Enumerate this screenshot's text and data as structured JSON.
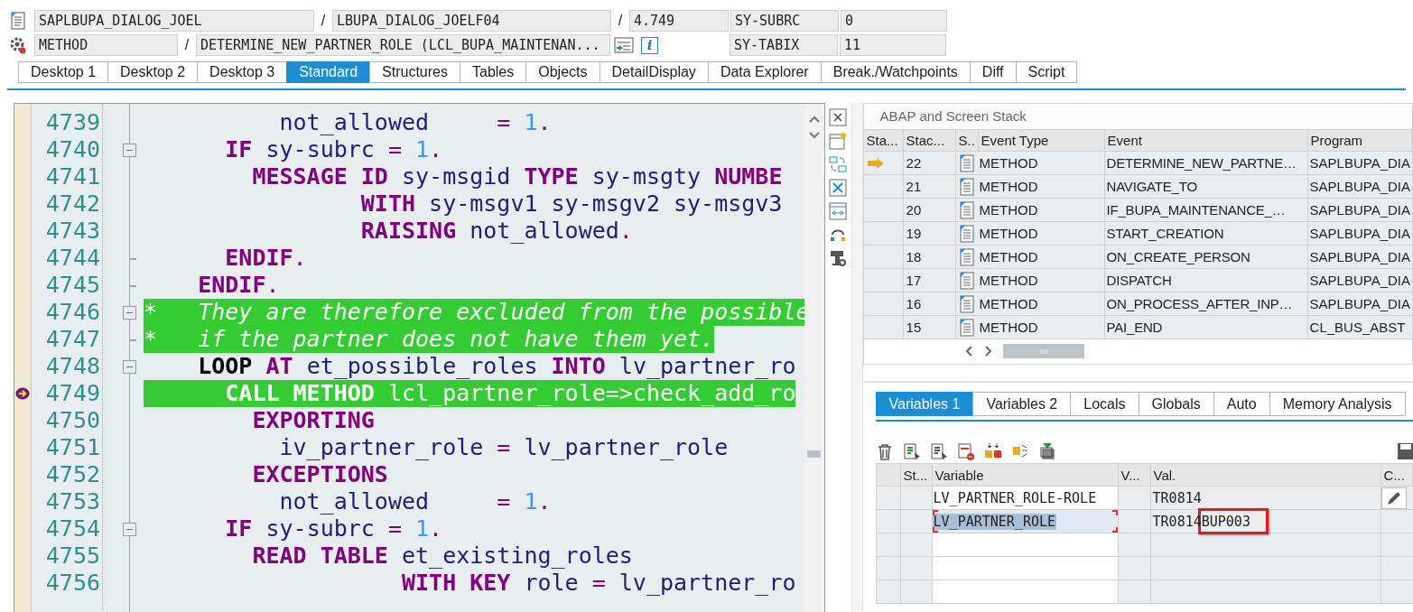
{
  "header": {
    "program": "SAPLBUPA_DIALOG_JOEL",
    "include": "LBUPA_DIALOG_JOELF04",
    "line": "4.749",
    "event_type": "METHOD",
    "event": "DETERMINE_NEW_PARTNER_ROLE (LCL_BUPA_MAINTENAN...",
    "separators": [
      "/",
      "/",
      "/"
    ],
    "info_icon": "i",
    "system_fields": [
      {
        "name": "SY-SUBRC",
        "value": "0"
      },
      {
        "name": "SY-TABIX",
        "value": "11"
      }
    ]
  },
  "tabs": [
    {
      "label": "Desktop 1",
      "selected": false
    },
    {
      "label": "Desktop 2",
      "selected": false
    },
    {
      "label": "Desktop 3",
      "selected": false
    },
    {
      "label": "Standard",
      "selected": true
    },
    {
      "label": "Structures",
      "selected": false
    },
    {
      "label": "Tables",
      "selected": false
    },
    {
      "label": "Objects",
      "selected": false
    },
    {
      "label": "DetailDisplay",
      "selected": false
    },
    {
      "label": "Data Explorer",
      "selected": false
    },
    {
      "label": "Break./Watchpoints",
      "selected": false
    },
    {
      "label": "Diff",
      "selected": false
    },
    {
      "label": "Script",
      "selected": false
    }
  ],
  "source": {
    "lines": [
      {
        "number": "4739",
        "highlighted": false,
        "current": false,
        "tokens": [
          {
            "kind": "identifier",
            "text": "          not_allowed"
          },
          {
            "kind": "operator",
            "text": "     ="
          },
          {
            "kind": "number",
            "text": " 1"
          },
          {
            "kind": "operator",
            "text": "."
          }
        ]
      },
      {
        "number": "4740",
        "highlighted": false,
        "current": false,
        "fold_start": true,
        "tokens": [
          {
            "kind": "keyword",
            "text": "      IF"
          },
          {
            "kind": "identifier",
            "text": " sy-subrc"
          },
          {
            "kind": "operator",
            "text": " ="
          },
          {
            "kind": "number",
            "text": " 1"
          },
          {
            "kind": "operator",
            "text": "."
          }
        ]
      },
      {
        "number": "4741",
        "highlighted": false,
        "current": false,
        "tokens": [
          {
            "kind": "keyword",
            "text": "        MESSAGE ID"
          },
          {
            "kind": "identifier",
            "text": " sy-msgid"
          },
          {
            "kind": "keyword",
            "text": " TYPE"
          },
          {
            "kind": "identifier",
            "text": " sy-msgty"
          },
          {
            "kind": "keyword",
            "text": " NUMBE"
          }
        ]
      },
      {
        "number": "4742",
        "highlighted": false,
        "current": false,
        "tokens": [
          {
            "kind": "keyword",
            "text": "                WITH"
          },
          {
            "kind": "identifier",
            "text": " sy-msgv1 sy-msgv2 sy-msgv3"
          }
        ]
      },
      {
        "number": "4743",
        "highlighted": false,
        "current": false,
        "tokens": [
          {
            "kind": "keyword",
            "text": "                RAISING"
          },
          {
            "kind": "identifier",
            "text": " not_allowed"
          },
          {
            "kind": "operator",
            "text": "."
          }
        ]
      },
      {
        "number": "4744",
        "highlighted": false,
        "current": false,
        "fold_end": true,
        "tokens": [
          {
            "kind": "keyword",
            "text": "      ENDIF"
          },
          {
            "kind": "operator",
            "text": "."
          }
        ]
      },
      {
        "number": "4745",
        "highlighted": false,
        "current": false,
        "fold_end": true,
        "tokens": [
          {
            "kind": "keyword",
            "text": "    ENDIF"
          },
          {
            "kind": "operator",
            "text": "."
          }
        ]
      },
      {
        "number": "4746",
        "highlighted": true,
        "current": false,
        "fold_start": true,
        "tokens": [
          {
            "kind": "comment",
            "text": "*   They are therefore excluded from the possible"
          }
        ]
      },
      {
        "number": "4747",
        "highlighted": true,
        "current": false,
        "fold_end": true,
        "tokens": [
          {
            "kind": "comment",
            "text": "*   if the partner does not have them yet."
          }
        ]
      },
      {
        "number": "4748",
        "highlighted": false,
        "current": false,
        "fold_start": true,
        "tokens": [
          {
            "kind": "block_keyword",
            "text": "    LOOP"
          },
          {
            "kind": "keyword",
            "text": " AT"
          },
          {
            "kind": "identifier",
            "text": " et_possible_roles"
          },
          {
            "kind": "keyword",
            "text": " INTO"
          },
          {
            "kind": "identifier",
            "text": " lv_partner_ro"
          }
        ]
      },
      {
        "number": "4749",
        "highlighted": true,
        "current": true,
        "tokens": [
          {
            "kind": "keyword",
            "text": "      CALL METHOD"
          },
          {
            "kind": "identifier",
            "text": " lcl_partner_role=>check_add_ro"
          }
        ]
      },
      {
        "number": "4750",
        "highlighted": false,
        "current": false,
        "tokens": [
          {
            "kind": "keyword",
            "text": "        EXPORTING"
          }
        ]
      },
      {
        "number": "4751",
        "highlighted": false,
        "current": false,
        "tokens": [
          {
            "kind": "identifier",
            "text": "          iv_partner_role"
          },
          {
            "kind": "operator",
            "text": " ="
          },
          {
            "kind": "identifier",
            "text": " lv_partner_role"
          }
        ]
      },
      {
        "number": "4752",
        "highlighted": false,
        "current": false,
        "tokens": [
          {
            "kind": "keyword",
            "text": "        EXCEPTIONS"
          }
        ]
      },
      {
        "number": "4753",
        "highlighted": false,
        "current": false,
        "tokens": [
          {
            "kind": "identifier",
            "text": "          not_allowed"
          },
          {
            "kind": "operator",
            "text": "     ="
          },
          {
            "kind": "number",
            "text": " 1"
          },
          {
            "kind": "operator",
            "text": "."
          }
        ]
      },
      {
        "number": "4754",
        "highlighted": false,
        "current": false,
        "fold_start": true,
        "tokens": [
          {
            "kind": "keyword",
            "text": "      IF"
          },
          {
            "kind": "identifier",
            "text": " sy-subrc"
          },
          {
            "kind": "operator",
            "text": " ="
          },
          {
            "kind": "number",
            "text": " 1"
          },
          {
            "kind": "operator",
            "text": "."
          }
        ]
      },
      {
        "number": "4755",
        "highlighted": false,
        "current": false,
        "tokens": [
          {
            "kind": "keyword",
            "text": "        READ TABLE"
          },
          {
            "kind": "identifier",
            "text": " et_existing_roles"
          }
        ]
      },
      {
        "number": "4756",
        "highlighted": false,
        "current": false,
        "tokens": [
          {
            "kind": "keyword",
            "text": "                   WITH KEY"
          },
          {
            "kind": "identifier",
            "text": " role"
          },
          {
            "kind": "operator",
            "text": " ="
          },
          {
            "kind": "identifier",
            "text": " lv_partner_ro"
          }
        ]
      }
    ]
  },
  "stack": {
    "title": "ABAP and Screen Stack",
    "columns": [
      "Sta...",
      "Stac...",
      "S..",
      "Event Type",
      "Event",
      "Program"
    ],
    "rows": [
      {
        "current": true,
        "depth": "22",
        "event_type": "METHOD",
        "event": "DETERMINE_NEW_PARTNE…",
        "program": "SAPLBUPA_DIA"
      },
      {
        "current": false,
        "depth": "21",
        "event_type": "METHOD",
        "event": "NAVIGATE_TO",
        "program": "SAPLBUPA_DIA"
      },
      {
        "current": false,
        "depth": "20",
        "event_type": "METHOD",
        "event": "IF_BUPA_MAINTENANCE_…",
        "program": "SAPLBUPA_DIA"
      },
      {
        "current": false,
        "depth": "19",
        "event_type": "METHOD",
        "event": "START_CREATION",
        "program": "SAPLBUPA_DIA"
      },
      {
        "current": false,
        "depth": "18",
        "event_type": "METHOD",
        "event": "ON_CREATE_PERSON",
        "program": "SAPLBUPA_DIA"
      },
      {
        "current": false,
        "depth": "17",
        "event_type": "METHOD",
        "event": "DISPATCH",
        "program": "SAPLBUPA_DIA"
      },
      {
        "current": false,
        "depth": "16",
        "event_type": "METHOD",
        "event": "ON_PROCESS_AFTER_INP…",
        "program": "SAPLBUPA_DIA"
      },
      {
        "current": false,
        "depth": "15",
        "event_type": "METHOD",
        "event": "PAI_END",
        "program": "CL_BUS_ABST"
      }
    ]
  },
  "variable_tabs": [
    {
      "label": "Variables 1",
      "selected": true
    },
    {
      "label": "Variables 2",
      "selected": false
    },
    {
      "label": "Locals",
      "selected": false
    },
    {
      "label": "Globals",
      "selected": false
    },
    {
      "label": "Auto",
      "selected": false
    },
    {
      "label": "Memory Analysis",
      "selected": false
    }
  ],
  "variables": {
    "columns": [
      "St...",
      "Variable",
      "V...",
      "Val.",
      "C..."
    ],
    "rows": [
      {
        "variable": "LV_PARTNER_ROLE-ROLE",
        "value": "TR0814",
        "selected": false,
        "annotated": false,
        "editable": true
      },
      {
        "variable": "LV_PARTNER_ROLE",
        "value": "TR0814BUP003",
        "selected": true,
        "annotated": true,
        "editable": false
      }
    ]
  }
}
